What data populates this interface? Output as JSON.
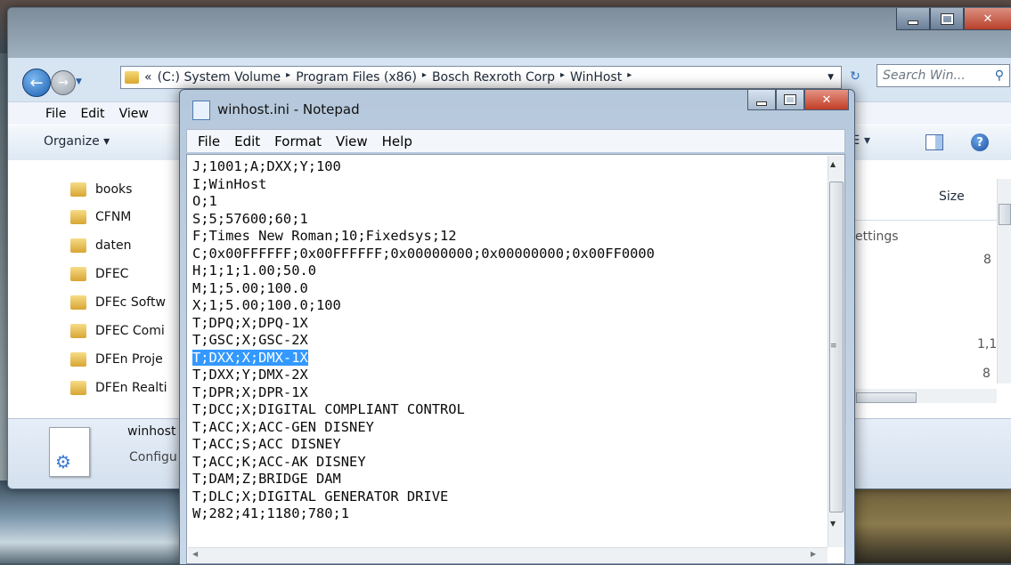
{
  "explorer": {
    "address": {
      "prefix": "«",
      "crumbs": [
        "(C:) System Volume",
        "Program Files (x86)",
        "Bosch Rexroth Corp",
        "WinHost"
      ],
      "sep": "▸"
    },
    "search_placeholder": "Search Win...",
    "menu": [
      "File",
      "Edit",
      "View"
    ],
    "organize_label": "Organize ▾",
    "nav_items": [
      "books",
      "CFNM",
      "daten",
      "DFEC",
      "DFEc Softw",
      "DFEC Comi",
      "DFEn Proje",
      "DFEn Realti"
    ],
    "columns": {
      "size": "Size",
      "settings": "ettings"
    },
    "size_values": [
      "8",
      "1,1",
      "8"
    ],
    "details": {
      "name": "winhost",
      "type": "Configu"
    }
  },
  "notepad": {
    "title": "winhost.ini - Notepad",
    "menu": [
      "File",
      "Edit",
      "Format",
      "View",
      "Help"
    ],
    "lines": [
      "J;1001;A;DXX;Y;100",
      "I;WinHost",
      "O;1",
      "S;5;57600;60;1",
      "F;Times New Roman;10;Fixedsys;12",
      "C;0x00FFFFFF;0x00FFFFFF;0x00000000;0x00000000;0x00FF0000",
      "H;1;1;1.00;50.0",
      "M;1;5.00;100.0",
      "X;1;5.00;100.0;100",
      "T;DPQ;X;DPQ-1X",
      "T;GSC;X;GSC-2X",
      "T;DXX;X;DMX-1X",
      "T;DXX;Y;DMX-2X",
      "T;DPR;X;DPR-1X",
      "T;DCC;X;DIGITAL COMPLIANT CONTROL",
      "T;ACC;X;ACC-GEN DISNEY",
      "T;ACC;S;ACC DISNEY",
      "T;ACC;K;ACC-AK DISNEY",
      "T;DAM;Z;BRIDGE DAM",
      "T;DLC;X;DIGITAL GENERATOR DRIVE",
      "W;282;41;1180;780;1"
    ],
    "selected_line": 11
  },
  "icons": {
    "back": "back-arrow-icon",
    "forward": "forward-arrow-icon",
    "refresh": "refresh-icon",
    "search": "search-icon",
    "help": "help-icon"
  }
}
